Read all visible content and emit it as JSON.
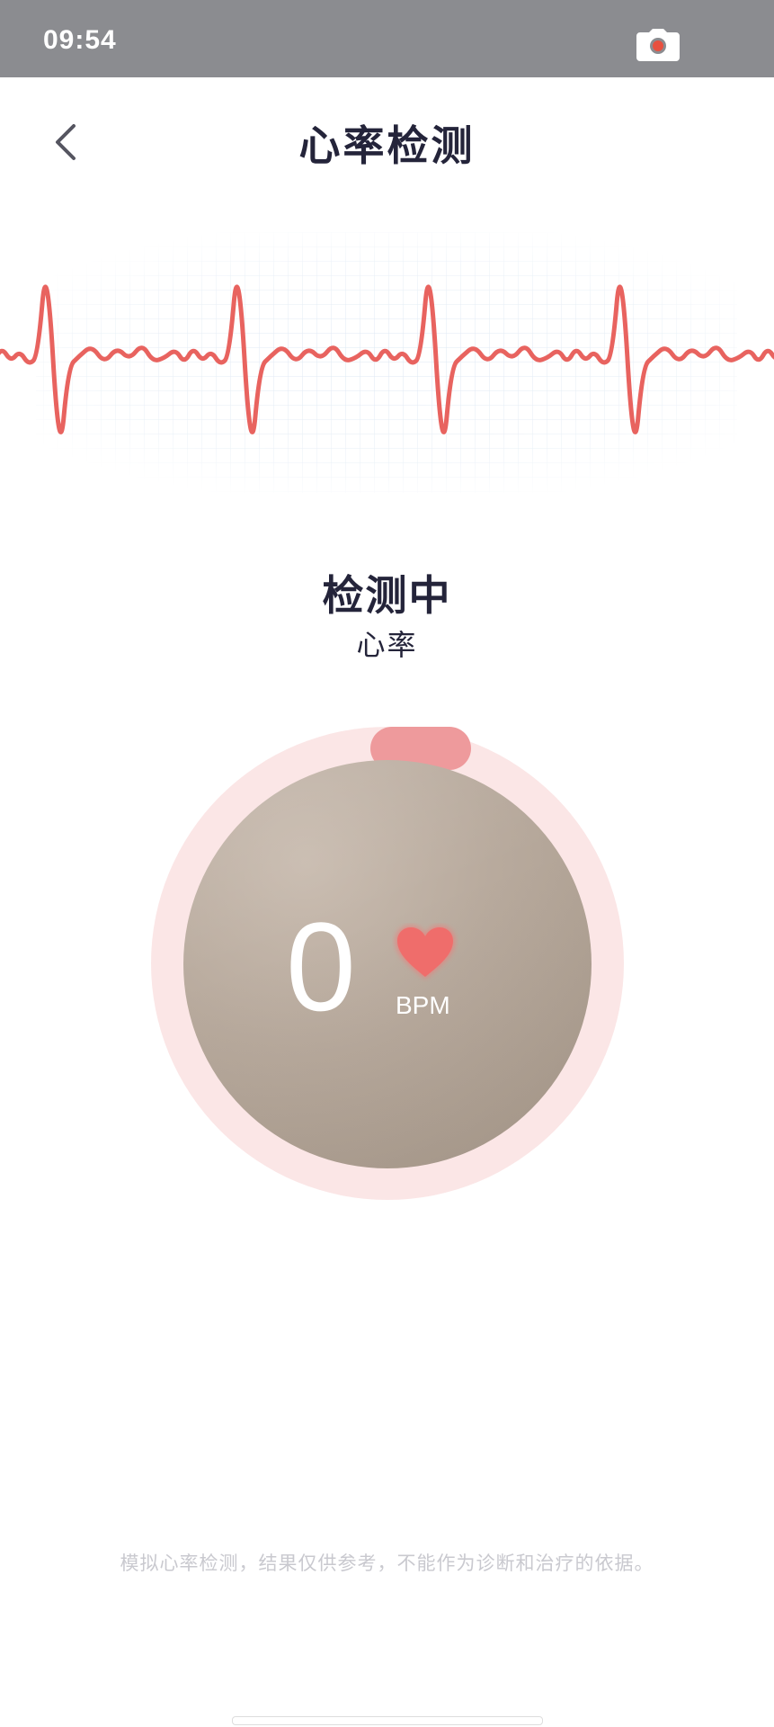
{
  "status_bar": {
    "time": "09:54",
    "icons": [
      "camera-icon"
    ]
  },
  "header": {
    "title": "心率检测",
    "back_icon": "chevron-left-icon"
  },
  "measurement": {
    "status": "检测中",
    "metric": "心率",
    "value": "0",
    "unit": "BPM",
    "icon": "heart-icon",
    "progress": 0.05
  },
  "disclaimer": "模拟心率检测，结果仅供参考，不能作为诊断和治疗的依据。",
  "colors": {
    "accent": "#e8635f",
    "ring": "#fbe6e6",
    "progress": "#ee9a9c",
    "title": "#24243a",
    "status_bar": "#8b8c90"
  }
}
